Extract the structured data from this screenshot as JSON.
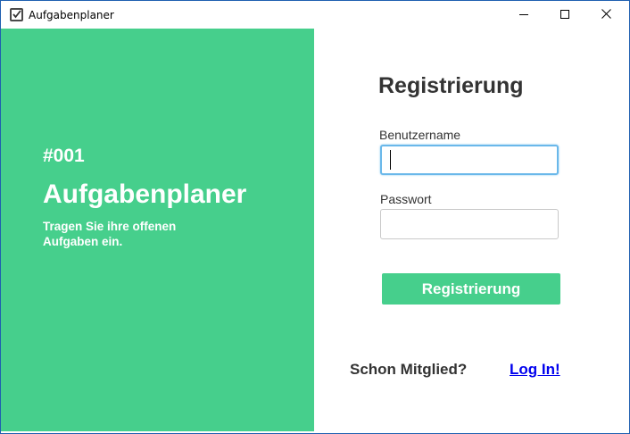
{
  "window": {
    "title": "Aufgabenplaner",
    "app_icon": "checklist-icon",
    "controls": [
      "minimize-icon",
      "maximize-icon",
      "close-icon"
    ]
  },
  "brand": {
    "number": "#001",
    "title": "Aufgabenplaner",
    "tagline": "Tragen Sie ihre offenen Aufgaben ein."
  },
  "form": {
    "heading": "Registrierung",
    "username_label": "Benutzername",
    "username_value": "",
    "password_label": "Passwort",
    "password_value": "",
    "submit_label": "Registrierung"
  },
  "footer": {
    "member_text": "Schon Mitglied?",
    "login_link": "Log In!"
  },
  "colors": {
    "accent": "#46cf8c",
    "text": "#333333",
    "link": "#0000ee",
    "focus_border": "#6ab8ea"
  }
}
